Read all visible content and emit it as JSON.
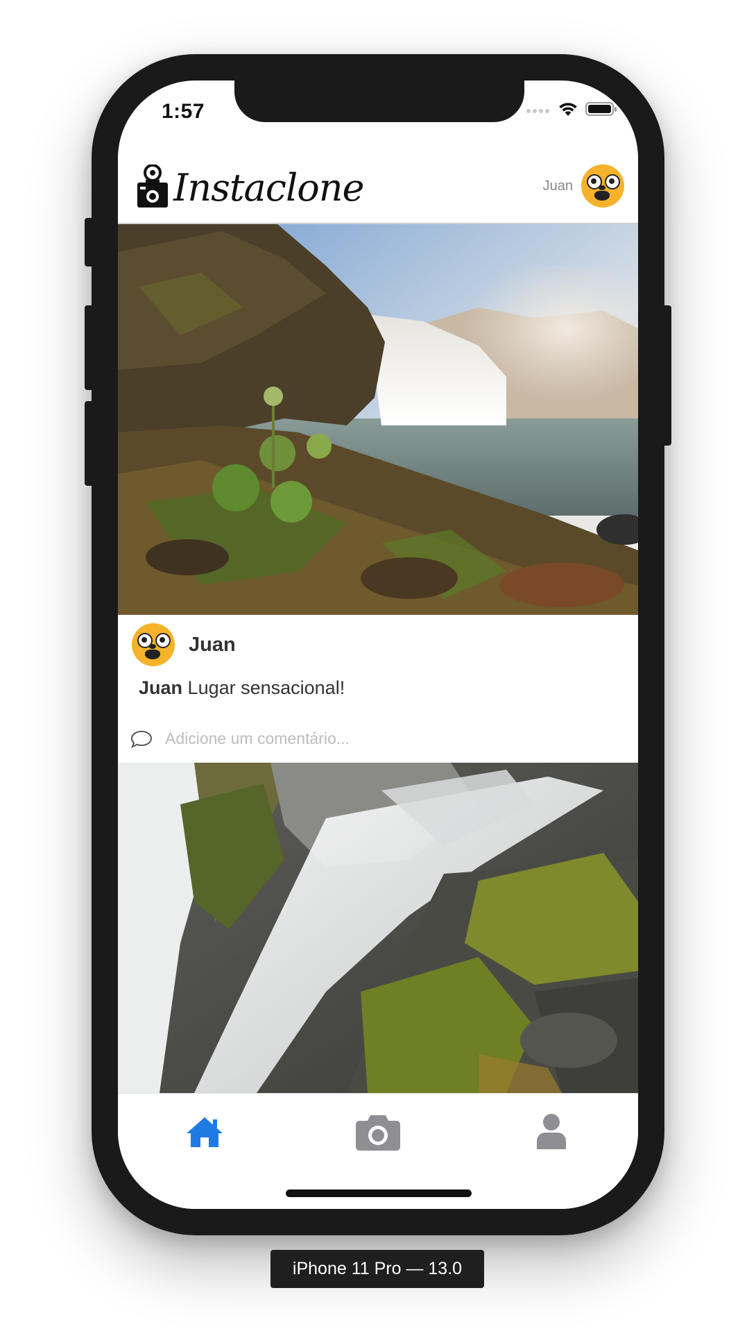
{
  "status_bar": {
    "time": "1:57"
  },
  "app": {
    "logo_text": "Instaclone"
  },
  "header": {
    "user_name": "Juan"
  },
  "post": {
    "author": "Juan",
    "caption_author": "Juan",
    "caption_text": "Lugar sensacional!",
    "comment_placeholder": "Adicione um comentário..."
  },
  "tabs": [
    {
      "name": "home",
      "icon": "home-icon",
      "active": true
    },
    {
      "name": "camera",
      "icon": "camera-icon",
      "active": false
    },
    {
      "name": "profile",
      "icon": "user-icon",
      "active": false
    }
  ],
  "colors": {
    "active_tab": "#1e7be6",
    "inactive_tab": "#8e8e93",
    "avatar": "#f5b22a"
  },
  "device_label": "iPhone 11 Pro — 13.0"
}
